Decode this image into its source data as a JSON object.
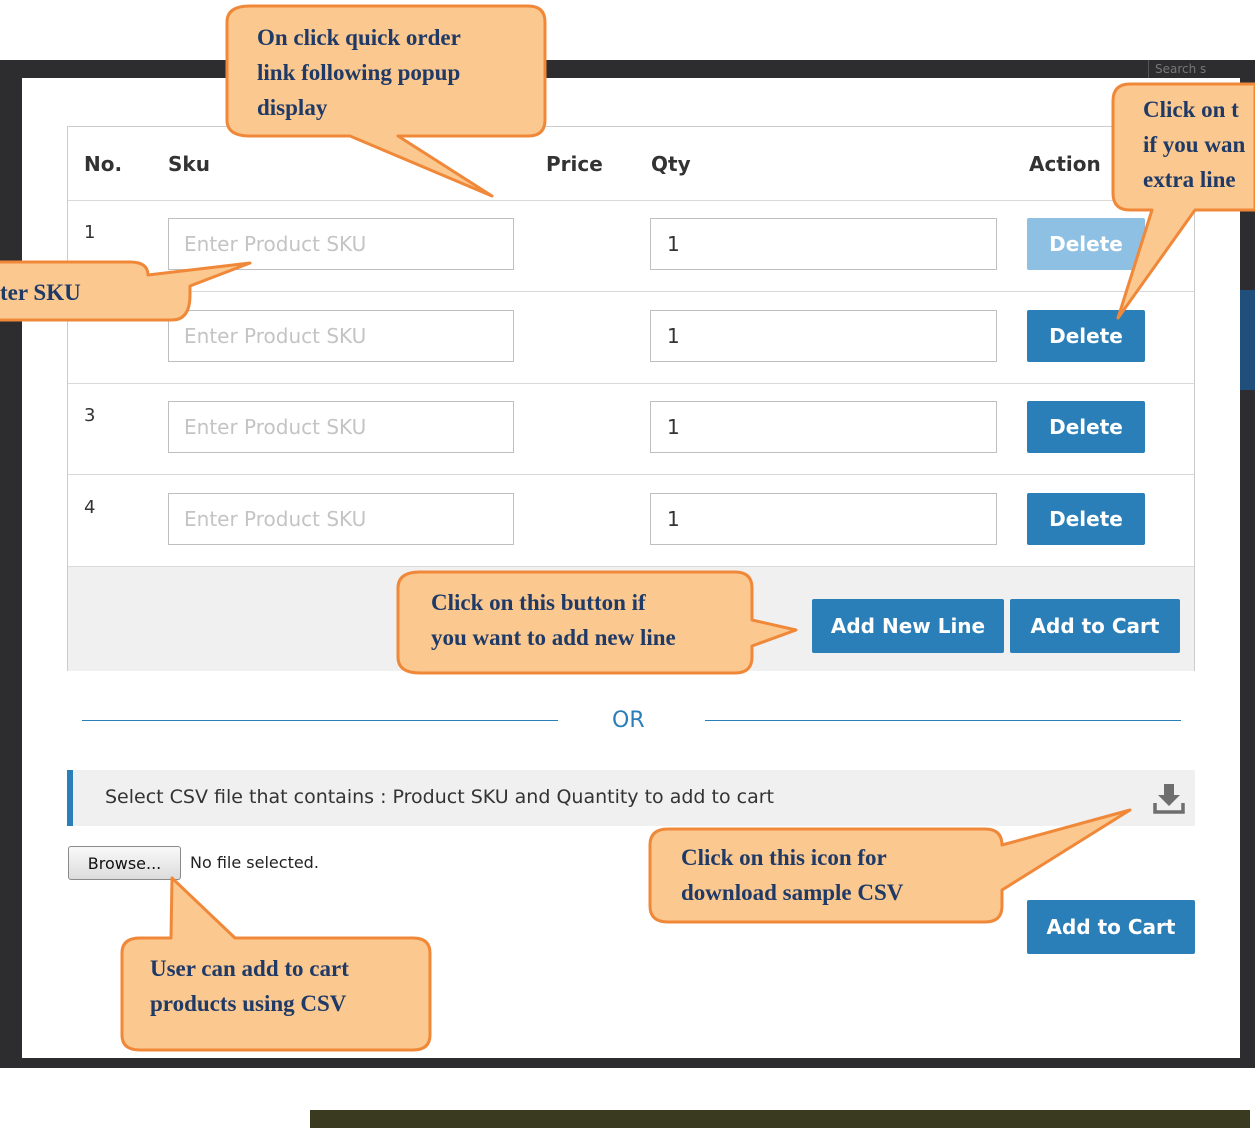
{
  "background": {
    "search_fragment": "Search s"
  },
  "table": {
    "headers": {
      "no": "No.",
      "sku": "Sku",
      "price": "Price",
      "qty": "Qty",
      "action": "Action"
    },
    "sku_placeholder": "Enter Product SKU",
    "rows": [
      {
        "num": "1",
        "qty": "1",
        "delete_label": "Delete",
        "delete_disabled": true
      },
      {
        "num": "",
        "qty": "1",
        "delete_label": "Delete",
        "delete_disabled": false
      },
      {
        "num": "3",
        "qty": "1",
        "delete_label": "Delete",
        "delete_disabled": false
      },
      {
        "num": "4",
        "qty": "1",
        "delete_label": "Delete",
        "delete_disabled": false
      }
    ],
    "add_new_line_label": "Add New Line",
    "add_to_cart_label": "Add to Cart"
  },
  "divider": {
    "text": "OR"
  },
  "csv": {
    "instructions": "Select CSV file that contains : Product SKU and Quantity to add to cart",
    "download_icon": "download-icon",
    "browse_label": "Browse...",
    "file_status": "No file selected.",
    "add_to_cart_label": "Add to Cart"
  },
  "callouts": {
    "quick_order": [
      "On click quick order",
      "link following popup",
      "display"
    ],
    "delete_line": [
      "Click on t",
      "if you wan",
      "extra line"
    ],
    "enter_sku": [
      "ter SKU"
    ],
    "add_new_line": [
      "Click on this button if",
      "you want to add new line"
    ],
    "download_csv": [
      "Click on this icon for",
      "download sample CSV"
    ],
    "csv_cart": [
      "User can add to cart",
      "products using CSV"
    ]
  },
  "colors": {
    "primary_button": "#2a7fb9",
    "disabled_button": "#8ec0e3",
    "callout_fill": "#fbc88f",
    "callout_border": "#f0883a",
    "callout_text": "#1f3a66"
  }
}
